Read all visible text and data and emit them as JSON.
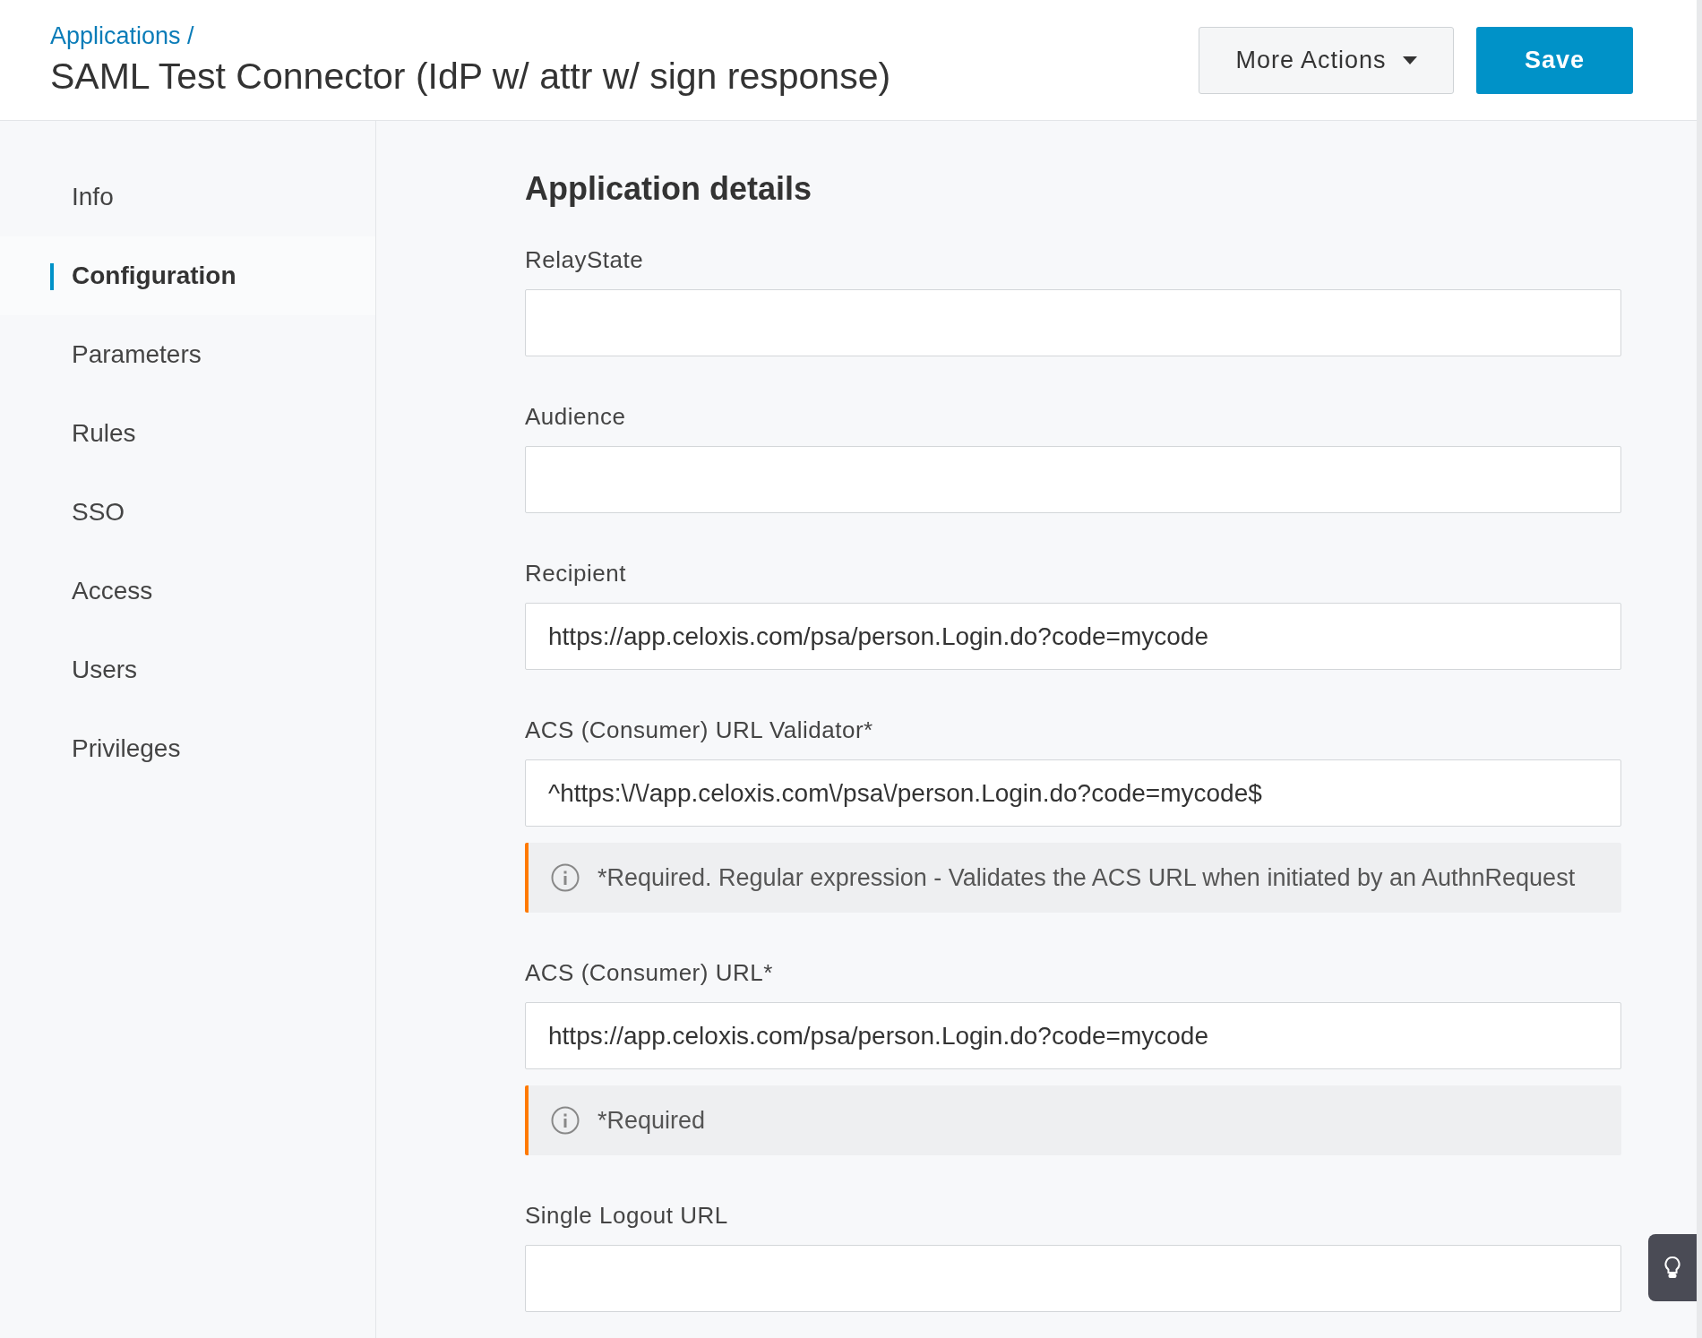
{
  "header": {
    "breadcrumb": "Applications /",
    "title": "SAML Test Connector (IdP w/ attr w/ sign response)",
    "more_actions": "More Actions",
    "save": "Save"
  },
  "sidebar": {
    "items": [
      {
        "label": "Info",
        "selected": false
      },
      {
        "label": "Configuration",
        "selected": true
      },
      {
        "label": "Parameters",
        "selected": false
      },
      {
        "label": "Rules",
        "selected": false
      },
      {
        "label": "SSO",
        "selected": false
      },
      {
        "label": "Access",
        "selected": false
      },
      {
        "label": "Users",
        "selected": false
      },
      {
        "label": "Privileges",
        "selected": false
      }
    ]
  },
  "content": {
    "heading": "Application details",
    "fields": [
      {
        "label": "RelayState"
      },
      {
        "label": "Audience"
      },
      {
        "label": "Recipient",
        "value": "https://app.celoxis.com/psa/person.Login.do?code=mycode"
      },
      {
        "label": "ACS (Consumer) URL Validator*",
        "value": "^https:\\/\\/app.celoxis.com\\/psa\\/person.Login.do?code=mycode$",
        "hint": "*Required. Regular expression - Validates the ACS URL when initiated by an AuthnRequest"
      },
      {
        "label": "ACS (Consumer) URL*",
        "value": "https://app.celoxis.com/psa/person.Login.do?code=mycode",
        "hint": "*Required"
      },
      {
        "label": "Single Logout URL"
      }
    ]
  }
}
